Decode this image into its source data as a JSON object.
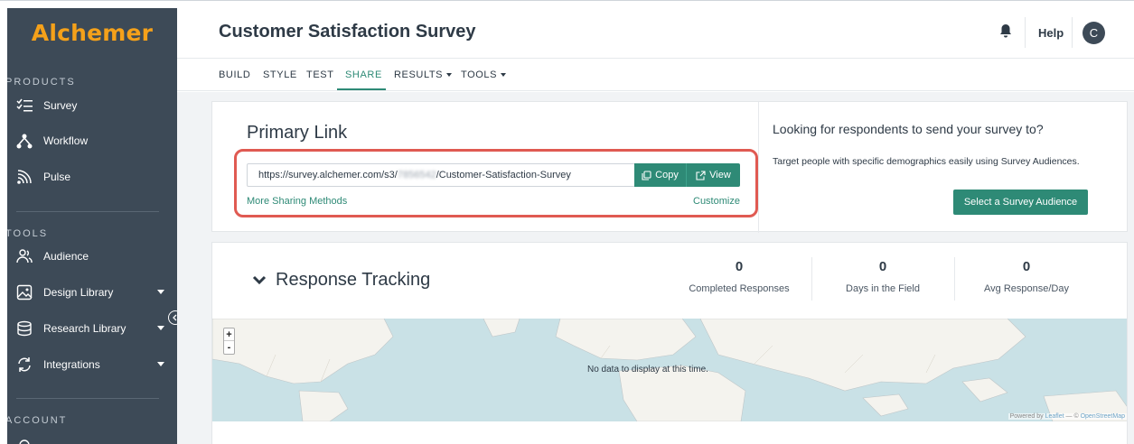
{
  "sidebar": {
    "logo": "Alchemer",
    "sections": {
      "products": "PRODUCTS",
      "tools": "TOOLS",
      "account": "ACCOUNT"
    },
    "products": [
      {
        "label": "Survey",
        "icon": "survey-list-icon"
      },
      {
        "label": "Workflow",
        "icon": "workflow-icon"
      },
      {
        "label": "Pulse",
        "icon": "pulse-icon"
      }
    ],
    "tools": [
      {
        "label": "Audience",
        "icon": "audience-icon"
      },
      {
        "label": "Design Library",
        "icon": "design-library-icon"
      },
      {
        "label": "Research Library",
        "icon": "research-library-icon"
      },
      {
        "label": "Integrations",
        "icon": "integrations-icon"
      }
    ]
  },
  "header": {
    "title": "Customer Satisfaction Survey",
    "help": "Help",
    "avatar_initial": "C"
  },
  "nav": {
    "tabs": [
      {
        "label": "BUILD"
      },
      {
        "label": "STYLE"
      },
      {
        "label": "TEST"
      },
      {
        "label": "SHARE",
        "active": true
      },
      {
        "label": "RESULTS"
      },
      {
        "label": "TOOLS"
      }
    ]
  },
  "primary_link": {
    "title": "Primary Link",
    "url_prefix": "https://survey.alchemer.com/s3/",
    "url_id": "7856542",
    "url_suffix": "/Customer-Satisfaction-Survey",
    "copy_label": "Copy",
    "view_label": "View",
    "more_sharing": "More Sharing Methods",
    "customize": "Customize"
  },
  "audience": {
    "title": "Looking for respondents to send your survey to?",
    "description": "Target people with specific demographics easily using Survey Audiences.",
    "button": "Select a Survey Audience"
  },
  "tracking": {
    "title": "Response Tracking",
    "stats": [
      {
        "value": "0",
        "label": "Completed Responses"
      },
      {
        "value": "0",
        "label": "Days in the Field"
      },
      {
        "value": "0",
        "label": "Avg Response/Day"
      }
    ],
    "map_message": "No data to display at this time.",
    "zoom_in": "+",
    "zoom_out": "-",
    "attribution_prefix": "Powered by ",
    "attribution_leaflet": "Leaflet",
    "attribution_sep": " — © ",
    "attribution_osm": "OpenStreetMap"
  },
  "colors": {
    "sidebar_bg": "#3d4a57",
    "logo": "#f5a11a",
    "accent": "#2e8a76",
    "highlight": "#e05a52",
    "map_water": "#c9e1e6"
  }
}
